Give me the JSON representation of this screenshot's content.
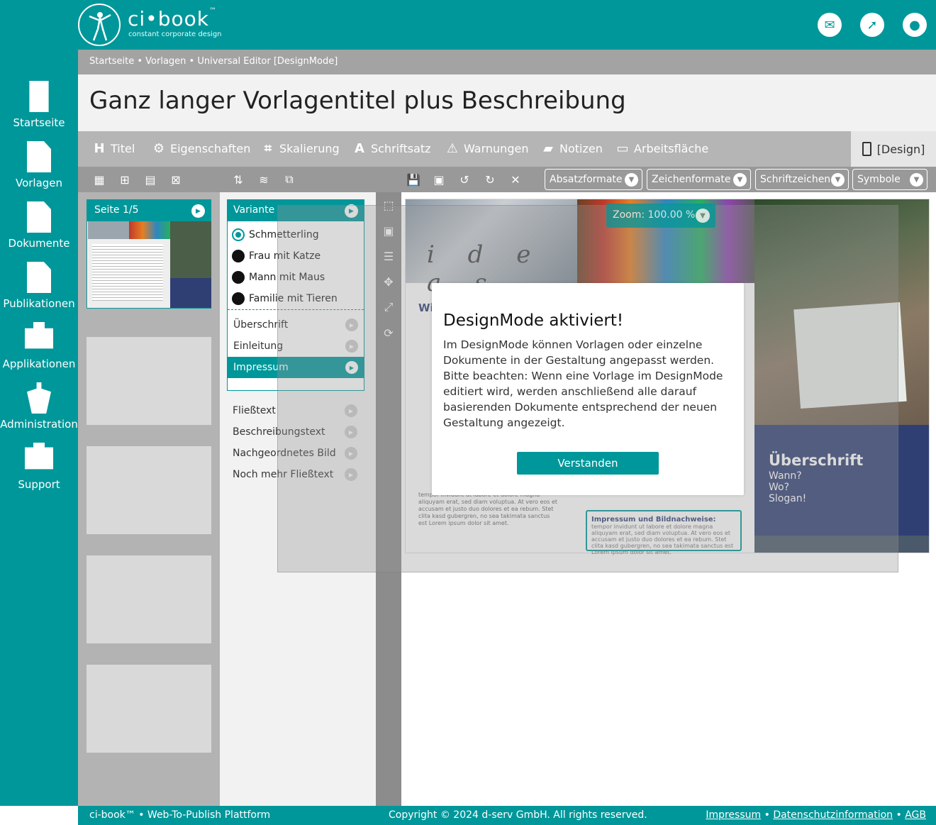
{
  "brand": {
    "name": "ci•book",
    "tm": "™",
    "tagline": "constant corporate design"
  },
  "header_icons": [
    "mail-icon",
    "compass-icon",
    "user-icon"
  ],
  "sidebar": {
    "items": [
      {
        "label": "Startseite",
        "icon": "building-icon"
      },
      {
        "label": "Vorlagen",
        "icon": "recipe-icon"
      },
      {
        "label": "Dokumente",
        "icon": "code-file-icon"
      },
      {
        "label": "Publikationen",
        "icon": "document-icon"
      },
      {
        "label": "Applikationen",
        "icon": "toolbox-icon"
      },
      {
        "label": "Administration",
        "icon": "tower-icon"
      },
      {
        "label": "Support",
        "icon": "medical-kit-icon"
      }
    ]
  },
  "breadcrumb": "Startseite • Vorlagen • Universal Editor [DesignMode]",
  "page_title": "Ganz langer Vorlagentitel plus Beschreibung",
  "tabs": [
    {
      "label": "Titel",
      "icon": "heading-icon"
    },
    {
      "label": "Eigenschaften",
      "icon": "gear-icon"
    },
    {
      "label": "Skalierung",
      "icon": "crop-icon"
    },
    {
      "label": "Schriftsatz",
      "icon": "font-icon"
    },
    {
      "label": "Warnungen",
      "icon": "warning-icon"
    },
    {
      "label": "Notizen",
      "icon": "note-icon"
    },
    {
      "label": "Arbeitsfläche",
      "icon": "monitor-icon"
    }
  ],
  "design_tab": "[Design]",
  "dropdowns": [
    "Absatzformate",
    "Zeichenformate",
    "Schriftzeichen",
    "Symbole"
  ],
  "page_panel": {
    "label": "Seite 1/5"
  },
  "variant_panel": {
    "header": "Variante",
    "options": [
      {
        "label": "Schmetterling",
        "selected": true
      },
      {
        "label": "Frau mit Katze",
        "selected": false
      },
      {
        "label": "Mann mit Maus",
        "selected": false
      },
      {
        "label": "Familie mit Tieren",
        "selected": false
      }
    ],
    "fields": [
      "Überschrift",
      "Einleitung",
      "Impressum"
    ],
    "active_field": "Impressum",
    "more_fields": [
      "Fließtext",
      "Beschreibungstext",
      "Nachgeordnetes Bild",
      "Noch mehr Fließtext"
    ]
  },
  "zoom": {
    "label": "Zoom: 100.00 %"
  },
  "document": {
    "ideas_text": "i d e a s",
    "heading_fragment": "Wi",
    "blue_box": {
      "title": "Überschrift",
      "lines": [
        "Wann?",
        "Wo?",
        "Slogan!"
      ]
    },
    "impressum_title": "Impressum und Bildnachweise:",
    "impressum_text": "tempor invidunt ut labore et dolore magna aliquyam erat, sed diam voluptua. At vero eos et accusam et justo duo dolores et ea rebum. Stet clita kasd gubergren, no sea takimata sanctus est Lorem ipsum dolor sit amet.",
    "body_text": "tempor invidunt ut labore et dolore magna aliquyam erat, sed diam voluptua. At vero eos et accusam et justo duo dolores et ea rebum. Stet clita kasd gubergren, no sea takimata sanctus est Lorem ipsum dolor sit amet."
  },
  "dialog": {
    "title": "DesignMode aktiviert!",
    "text": "Im DesignMode können Vorlagen oder einzelne Dokumente in der Gestaltung angepasst werden. Bitte beachten: Wenn eine Vorlage im DesignMode editiert wird, werden anschließend alle darauf basierenden Dokumente entsprechend der neuen Gestaltung angezeigt.",
    "button": "Verstanden"
  },
  "footer": {
    "left": "ci-book™ • Web-To-Publish Plattform",
    "center": "Copyright © 2024 d-serv GmbH. All rights reserved.",
    "links": [
      "Impressum",
      "Datenschutzinformation",
      "AGB"
    ],
    "sep": "•"
  },
  "colors": {
    "accent": "#00979a",
    "doc_blue": "#2f3f74"
  }
}
